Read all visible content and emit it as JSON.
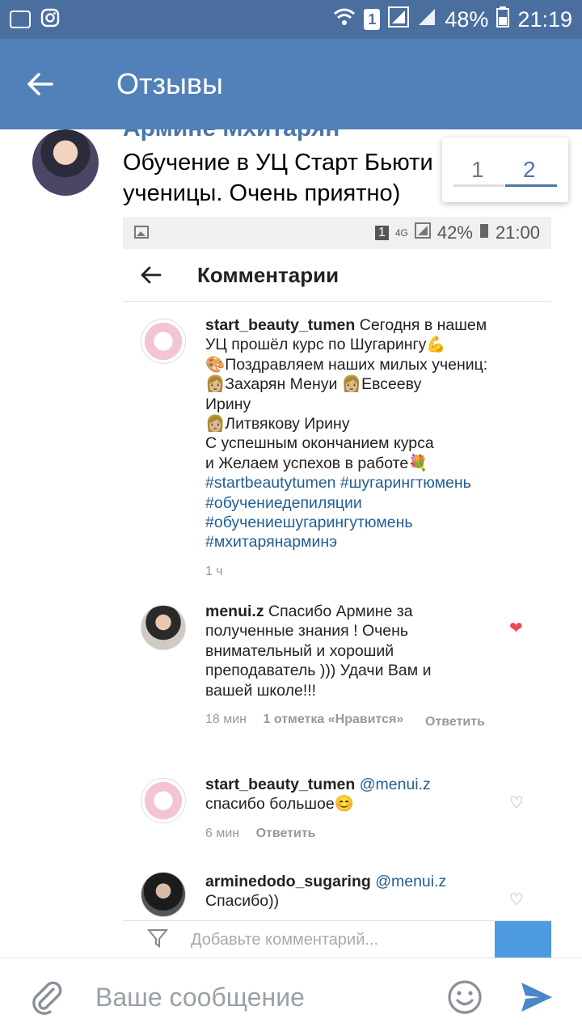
{
  "status_bar": {
    "battery": "48%",
    "time": "21:19",
    "sim": "1"
  },
  "app_bar": {
    "title": "Отзывы"
  },
  "message": {
    "author": "Армине Мхитарян",
    "text_line1": "Обучение в УЦ Старт Бьюти",
    "text_line2": "ученицы. Очень приятно)"
  },
  "pager": {
    "page1": "1",
    "page2": "2"
  },
  "screenshot": {
    "status_bar": {
      "battery": "42%",
      "time": "21:00",
      "network": "4G",
      "sim": "1"
    },
    "header_title": "Комментарии",
    "comments": [
      {
        "username": "start_beauty_tumen",
        "lines": [
          "Сегодня в нашем",
          "УЦ прошёл курс по Шугарингу💪",
          "🎨Поздравляем наших милых учениц:",
          "👩🏼Захарян Менуи 👩🏼Евсееву",
          "Ирину",
          "👩🏼Литвякову Ирину",
          "С успешным окончанием курса",
          "и Желаем успехов в работе💐"
        ],
        "tags": [
          "#startbeautytumen #шугарингтюмень",
          "#обучениедепиляции",
          "#обучениешугарингутюмень",
          "#мхитарянарминэ"
        ],
        "time": "1 ч"
      },
      {
        "username": "menui.z",
        "text": "Спасибо Армине за полученные знания ! Очень внимательный и хороший преподаватель ))) Удачи Вам и вашей школе!!!",
        "time": "18 мин",
        "likes": "1 отметка «Нравится»",
        "reply": "Ответить"
      },
      {
        "username": "start_beauty_tumen",
        "mention": "@menui.z",
        "text": "спасибо большое😊",
        "time": "6 мин",
        "reply": "Ответить"
      },
      {
        "username": "arminedodo_sugaring",
        "mention": "@menui.z",
        "text": "Спасибо))"
      }
    ],
    "composer_placeholder": "Добавьте комментарий..."
  },
  "bottom_bar": {
    "placeholder": "Ваше сообщение"
  },
  "colors": {
    "status_bar": "#4a6f9f",
    "app_bar": "#5181b8",
    "link": "#4a76a8",
    "like": "#ed4956"
  }
}
